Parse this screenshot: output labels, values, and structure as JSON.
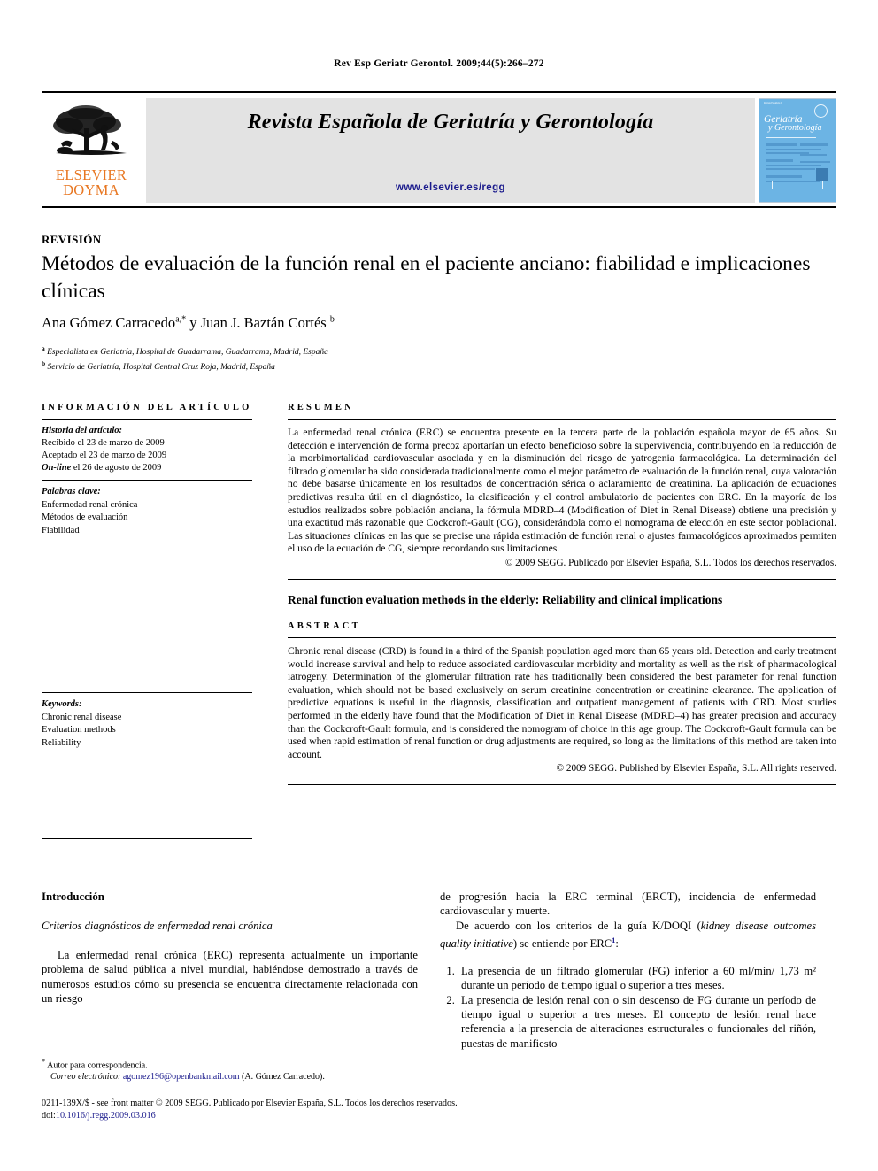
{
  "running_head": "Rev Esp Geriatr Gerontol. 2009;44(5):266–272",
  "masthead": {
    "publisher_line1": "ELSEVIER",
    "publisher_line2": "DOYMA",
    "journal_title": "Revista Española de Geriatría y Gerontología",
    "journal_url": "www.elsevier.es/regg",
    "cover": {
      "top_label": "Revista Española de",
      "title_line1": "Geriatría",
      "title_line2": "y Gerontología",
      "volume_line": "Volumen 44, Número 5, Septiembre-Octubre 2009"
    }
  },
  "article": {
    "kicker": "REVISIÓN",
    "title": "Métodos de evaluación de la función renal en el paciente anciano: fiabilidad e implicaciones clínicas",
    "authors": "Ana Gómez Carracedo",
    "author_sup_a": "a,*",
    "authors_joiner": " y Juan J. Baztán Cortés ",
    "author_sup_b": "b",
    "affiliation_a_marker": "a",
    "affiliation_a": " Especialista en Geriatría, Hospital de Guadarrama, Guadarrama, Madrid, España",
    "affiliation_b_marker": "b",
    "affiliation_b": " Servicio de Geriatría, Hospital Central Cruz Roja, Madrid, España"
  },
  "info_panel": {
    "heading": "INFORMACIÓN DEL ARTÍCULO",
    "history_label": "Historia del artículo:",
    "history": [
      "Recibido el 23 de marzo de 2009",
      "Aceptado el 23 de marzo de 2009"
    ],
    "online_label": "On-line",
    "online_rest": " el 26 de agosto de 2009",
    "keywords_label": "Palabras clave:",
    "keywords": [
      "Enfermedad renal crónica",
      "Métodos de evaluación",
      "Fiabilidad"
    ]
  },
  "resumen": {
    "heading": "RESUMEN",
    "text": "La enfermedad renal crónica (ERC) se encuentra presente en la tercera parte de la población española mayor de 65 años. Su detección e intervención de forma precoz aportarían un efecto beneficioso sobre la supervivencia, contribuyendo en la reducción de la morbimortalidad cardiovascular asociada y en la disminución del riesgo de yatrogenia farmacológica. La determinación del filtrado glomerular ha sido considerada tradicionalmente como el mejor parámetro de evaluación de la función renal, cuya valoración no debe basarse únicamente en los resultados de concentración sérica o aclaramiento de creatinina. La aplicación de ecuaciones predictivas resulta útil en el diagnóstico, la clasificación y el control ambulatorio de pacientes con ERC. En la mayoría de los estudios realizados sobre población anciana, la fórmula MDRD–4 (Modification of Diet in Renal Disease) obtiene una precisión y una exactitud más razonable que Cockcroft-Gault (CG), considerándola como el nomograma de elección en este sector poblacional. Las situaciones clínicas en las que se precise una rápida estimación de función renal o ajustes farmacológicos aproximados permiten el uso de la ecuación de CG, siempre recordando sus limitaciones.",
    "copyright": "© 2009 SEGG. Publicado por Elsevier España, S.L. Todos los derechos reservados."
  },
  "english": {
    "title": "Renal function evaluation methods in the elderly: Reliability and clinical implications",
    "abstract_heading": "ABSTRACT",
    "keywords_label": "Keywords:",
    "keywords": [
      "Chronic renal disease",
      "Evaluation methods",
      "Reliability"
    ],
    "text": "Chronic renal disease (CRD) is found in a third of the Spanish population aged more than 65 years old. Detection and early treatment would increase survival and help to reduce associated cardiovascular morbidity and mortality as well as the risk of pharmacological iatrogeny. Determination of the glomerular filtration rate has traditionally been considered the best parameter for renal function evaluation, which should not be based exclusively on serum creatinine concentration or creatinine clearance. The application of predictive equations is useful in the diagnosis, classification and outpatient management of patients with CRD. Most studies performed in the elderly have found that the Modification of Diet in Renal Disease (MDRD–4) has greater precision and accuracy than the Cockcroft-Gault formula, and is considered the nomogram of choice in this age group. The Cockcroft-Gault formula can be used when rapid estimation of renal function or drug adjustments are required, so long as the limitations of this method are taken into account.",
    "copyright": "© 2009 SEGG. Published by Elsevier España, S.L. All rights reserved."
  },
  "body": {
    "section_heading": "Introducción",
    "subsection_heading": "Criterios diagnósticos de enfermedad renal crónica",
    "left_paragraph": "La enfermedad renal crónica (ERC) representa actualmente un importante problema de salud pública a nivel mundial, habiéndose demostrado a través de numerosos estudios cómo su presencia se encuentra directamente relacionada con un riesgo",
    "right_paragraph_continued": "de progresión hacia la ERC terminal (ERCT), incidencia de enfermedad cardiovascular y muerte.",
    "right_paragraph_2_pre": "De acuerdo con los criterios de la guía K/DOQI (",
    "right_paragraph_2_italic": "kidney disease outcomes quality initiative",
    "right_paragraph_2_post": ") se entiende por ERC",
    "right_paragraph_2_ref": "1",
    "right_paragraph_2_end": ":",
    "criteria": [
      "La presencia de un filtrado glomerular (FG) inferior a 60 ml/min/ 1,73 m² durante un período de tiempo igual o superior a tres meses.",
      "La presencia de lesión renal con o sin descenso de FG durante un período de tiempo igual o superior a tres meses. El concepto de lesión renal hace referencia a la presencia de alteraciones estructurales o funcionales del riñón, puestas de manifiesto"
    ]
  },
  "footnote": {
    "marker": "*",
    "corresponding": " Autor para correspondencia.",
    "email_label": "Correo electrónico:",
    "email": "agomez196@openbankmail.com",
    "email_owner": " (A. Gómez Carracedo)."
  },
  "page_footer": {
    "issn_line": "0211-139X/$ - see front matter © 2009 SEGG. Publicado por Elsevier España, S.L. Todos los derechos reservados.",
    "doi_label": "doi:",
    "doi": "10.1016/j.regg.2009.03.016"
  },
  "colors": {
    "elsevier_orange": "#E87722",
    "link_blue": "#1a1a8c",
    "banner_grey": "#e3e3e3",
    "cover_blue": "#6cb4e4"
  }
}
